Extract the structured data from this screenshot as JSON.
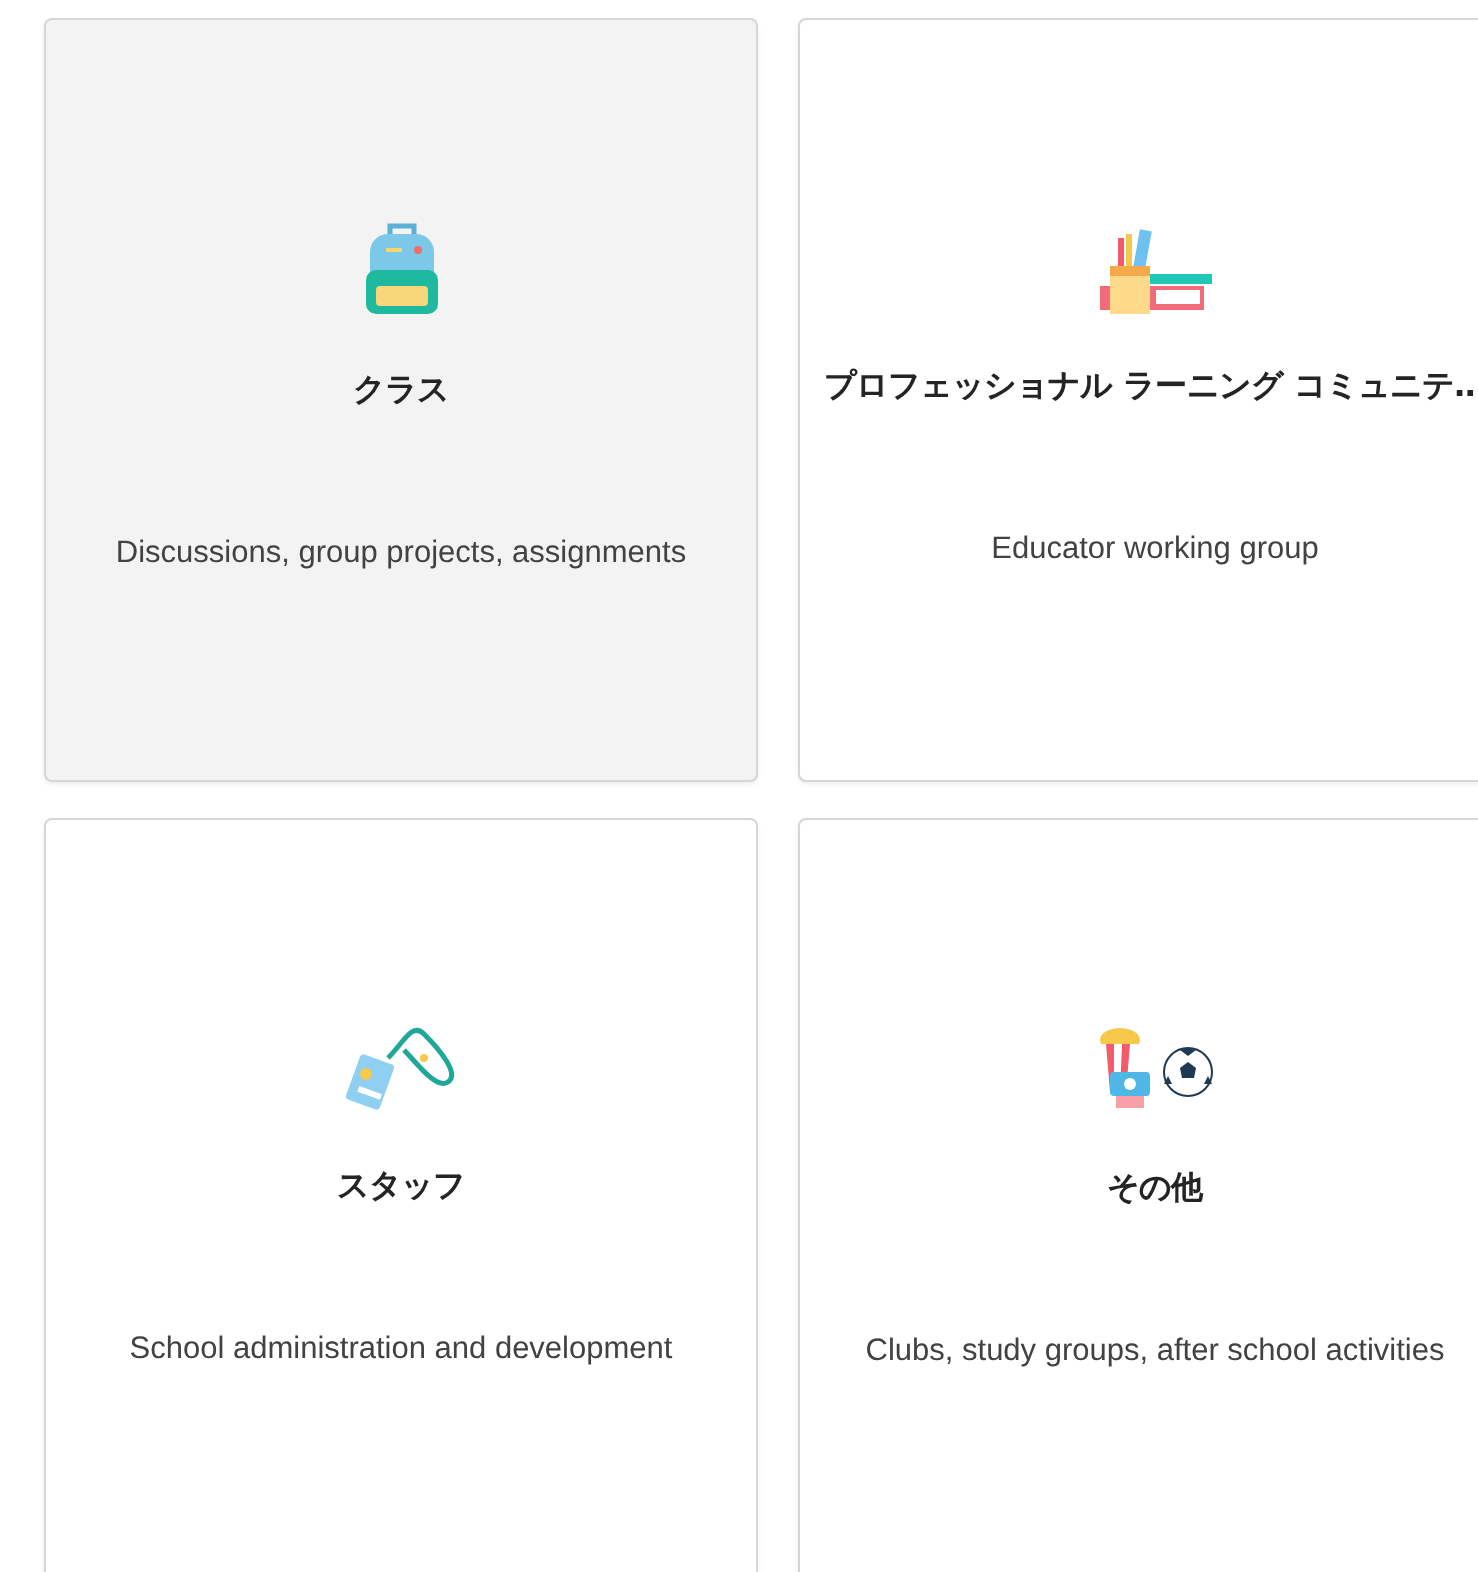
{
  "cards": [
    {
      "title": "クラス",
      "description": "Discussions, group projects, assignments",
      "selected": true
    },
    {
      "title": "プロフェッショナル ラーニング コミュニテ…",
      "description": "Educator working group",
      "selected": false
    },
    {
      "title": "スタッフ",
      "description": "School administration and development",
      "selected": false
    },
    {
      "title": "その他",
      "description": "Clubs, study groups, after school activities",
      "selected": false
    }
  ]
}
